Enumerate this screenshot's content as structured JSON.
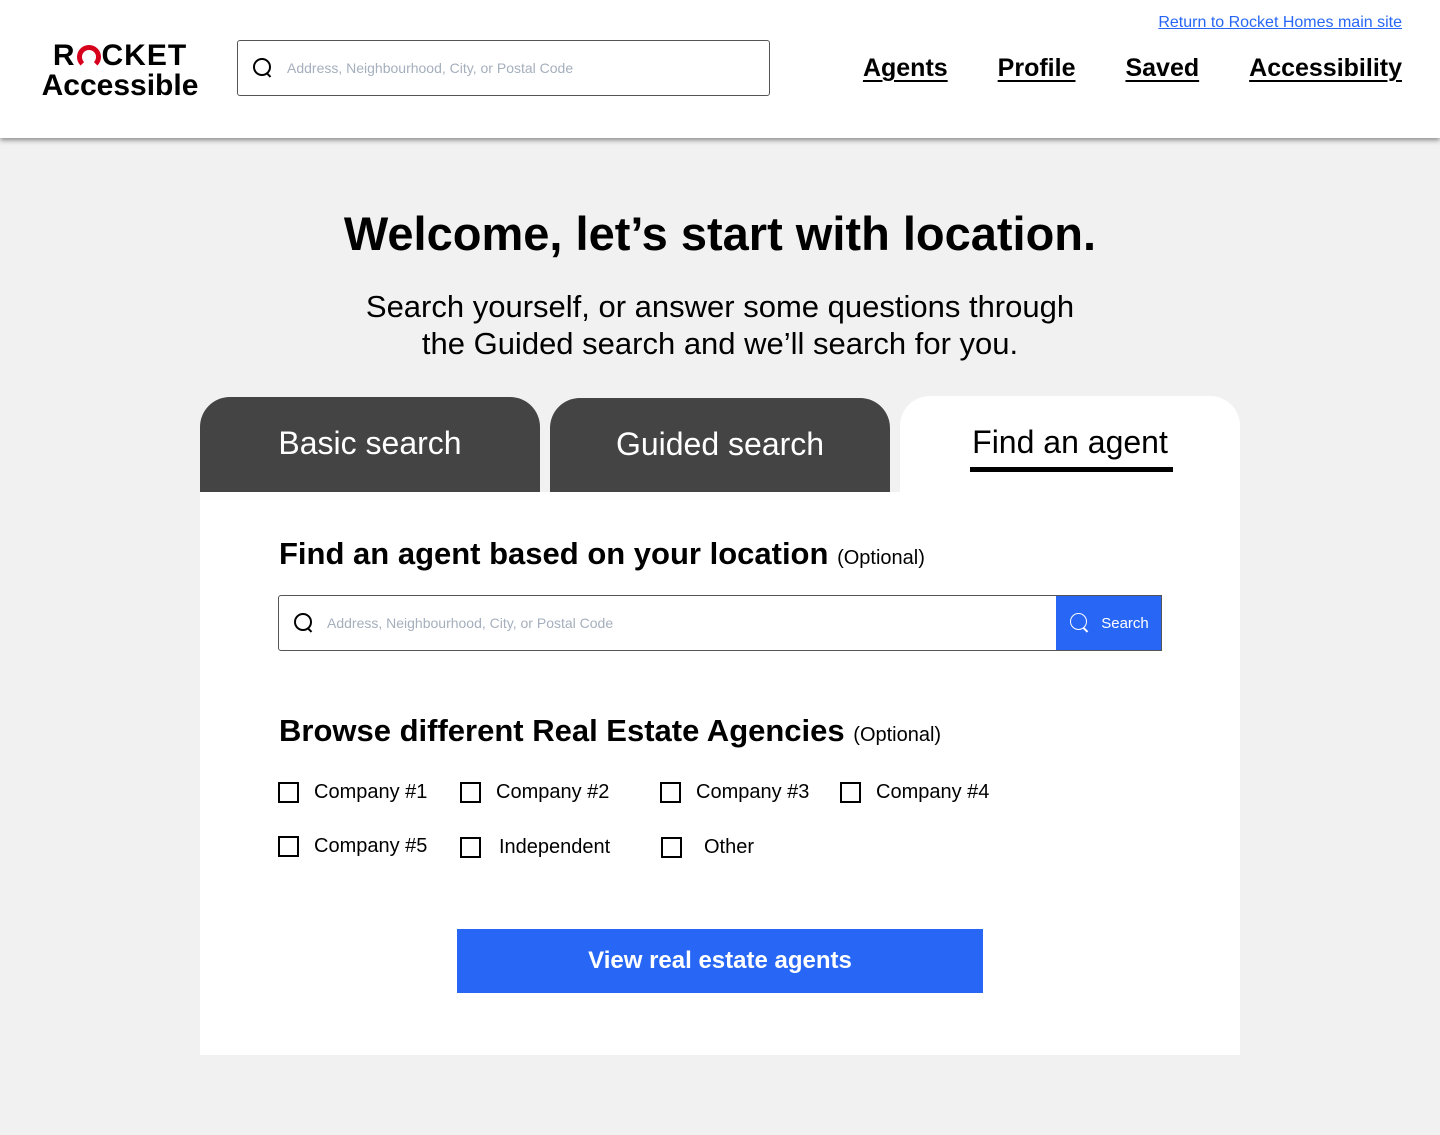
{
  "header": {
    "logo": {
      "line1_pre": "R",
      "line1_post": "CKET",
      "line2": "Accessible",
      "accent_color": "#d6001c"
    },
    "search": {
      "placeholder": "Address, Neighbourhood, City, or Postal Code",
      "value": ""
    },
    "return_link": "Return to Rocket Homes main site",
    "nav": [
      "Agents",
      "Profile",
      "Saved",
      "Accessibility"
    ]
  },
  "hero": {
    "title": "Welcome, let’s start with location.",
    "subtitle_line1": "Search yourself, or answer some questions through",
    "subtitle_line2": "the Guided search and we’ll search for you."
  },
  "tabs": [
    {
      "label": "Basic search",
      "active": false
    },
    {
      "label": "Guided search",
      "active": false
    },
    {
      "label": "Find an agent",
      "active": true
    }
  ],
  "panel": {
    "location_title": "Find an agent based on your location",
    "location_optional": "(Optional)",
    "agent_search": {
      "placeholder": "Address, Neighbourhood, City, or Postal Code",
      "value": "",
      "button_label": "Search"
    },
    "agencies_title": "Browse different Real Estate Agencies",
    "agencies_optional": "(Optional)",
    "agencies": [
      {
        "label": "Company #1",
        "checked": false
      },
      {
        "label": "Company #2",
        "checked": false
      },
      {
        "label": "Company #3",
        "checked": false
      },
      {
        "label": "Company #4",
        "checked": false
      },
      {
        "label": "Company #5",
        "checked": false
      },
      {
        "label": "Independent",
        "checked": false
      },
      {
        "label": "Other",
        "checked": false
      }
    ],
    "cta_label": "View real estate agents"
  },
  "colors": {
    "primary": "#2867f6",
    "tab_inactive": "#444444",
    "background": "#f1f1f1"
  }
}
